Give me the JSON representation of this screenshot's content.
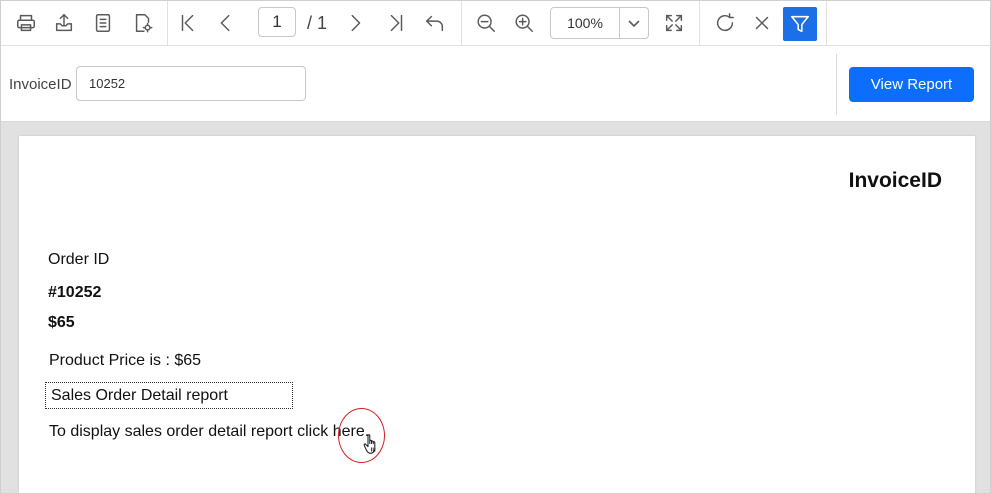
{
  "toolbar": {
    "icons": [
      "print-icon",
      "export-icon",
      "document-icon",
      "page-setup-icon",
      "first-page-icon",
      "previous-page-icon",
      "next-page-icon",
      "last-page-icon",
      "back-icon",
      "zoom-out-icon",
      "zoom-in-icon",
      "fit-page-icon",
      "refresh-icon",
      "close-icon",
      "filter-icon"
    ],
    "current_page": "1",
    "total_pages": "/ 1",
    "zoom": "100%"
  },
  "parameters": {
    "label": "InvoiceID",
    "value": "10252",
    "view_report_label": "View Report"
  },
  "report": {
    "title": "InvoiceID",
    "order_label": "Order ID",
    "order_id": "#10252",
    "price": "$65",
    "product_price_text": "Product Price is : $65",
    "subreport_title": "Sales Order Detail report",
    "link_text_before": "To display sales order detail report click ",
    "link_text": "here."
  },
  "colors": {
    "accent": "#0d6efd",
    "filter_active": "#1d6fe8",
    "callout": "#d32020"
  }
}
